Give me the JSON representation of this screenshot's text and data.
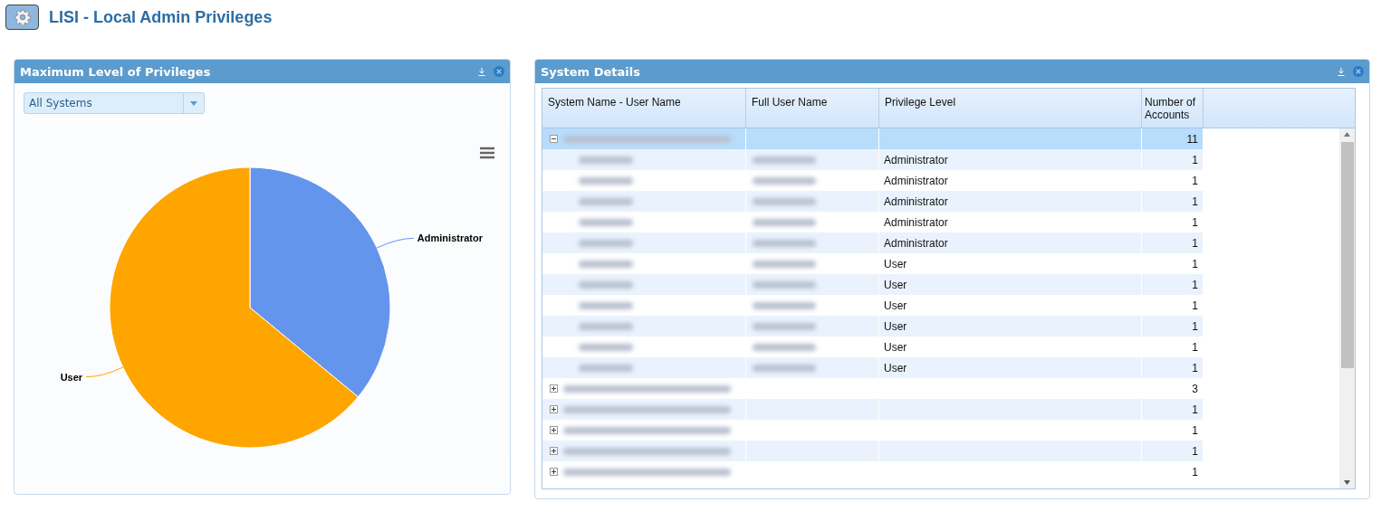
{
  "page": {
    "title": "LISI - Local Admin Privileges"
  },
  "left_panel": {
    "title": "Maximum Level of Privileges",
    "filter": {
      "value": "All Systems"
    },
    "chart_data": {
      "type": "pie",
      "categories": [
        "Administrator",
        "User"
      ],
      "values": [
        36,
        64
      ],
      "colors": [
        "#6495ed",
        "#ffa500"
      ]
    }
  },
  "right_panel": {
    "title": "System Details",
    "columns": [
      "System Name - User Name",
      "Full User Name",
      "Privilege Level",
      "Number of Accounts"
    ],
    "rows": [
      {
        "kind": "group",
        "expanded": true,
        "selected": true,
        "count": "11"
      },
      {
        "kind": "child",
        "privilege": "Administrator",
        "count": "1"
      },
      {
        "kind": "child",
        "privilege": "Administrator",
        "count": "1"
      },
      {
        "kind": "child",
        "privilege": "Administrator",
        "count": "1"
      },
      {
        "kind": "child",
        "privilege": "Administrator",
        "count": "1"
      },
      {
        "kind": "child",
        "privilege": "Administrator",
        "count": "1"
      },
      {
        "kind": "child",
        "privilege": "User",
        "count": "1"
      },
      {
        "kind": "child",
        "privilege": "User",
        "count": "1"
      },
      {
        "kind": "child",
        "privilege": "User",
        "count": "1"
      },
      {
        "kind": "child",
        "privilege": "User",
        "count": "1"
      },
      {
        "kind": "child",
        "privilege": "User",
        "count": "1"
      },
      {
        "kind": "child",
        "privilege": "User",
        "count": "1"
      },
      {
        "kind": "group",
        "expanded": false,
        "selected": false,
        "count": "3"
      },
      {
        "kind": "group",
        "expanded": false,
        "selected": false,
        "count": "1"
      },
      {
        "kind": "group",
        "expanded": false,
        "selected": false,
        "count": "1"
      },
      {
        "kind": "group",
        "expanded": false,
        "selected": false,
        "count": "1"
      },
      {
        "kind": "group",
        "expanded": false,
        "selected": false,
        "count": "1"
      }
    ]
  }
}
